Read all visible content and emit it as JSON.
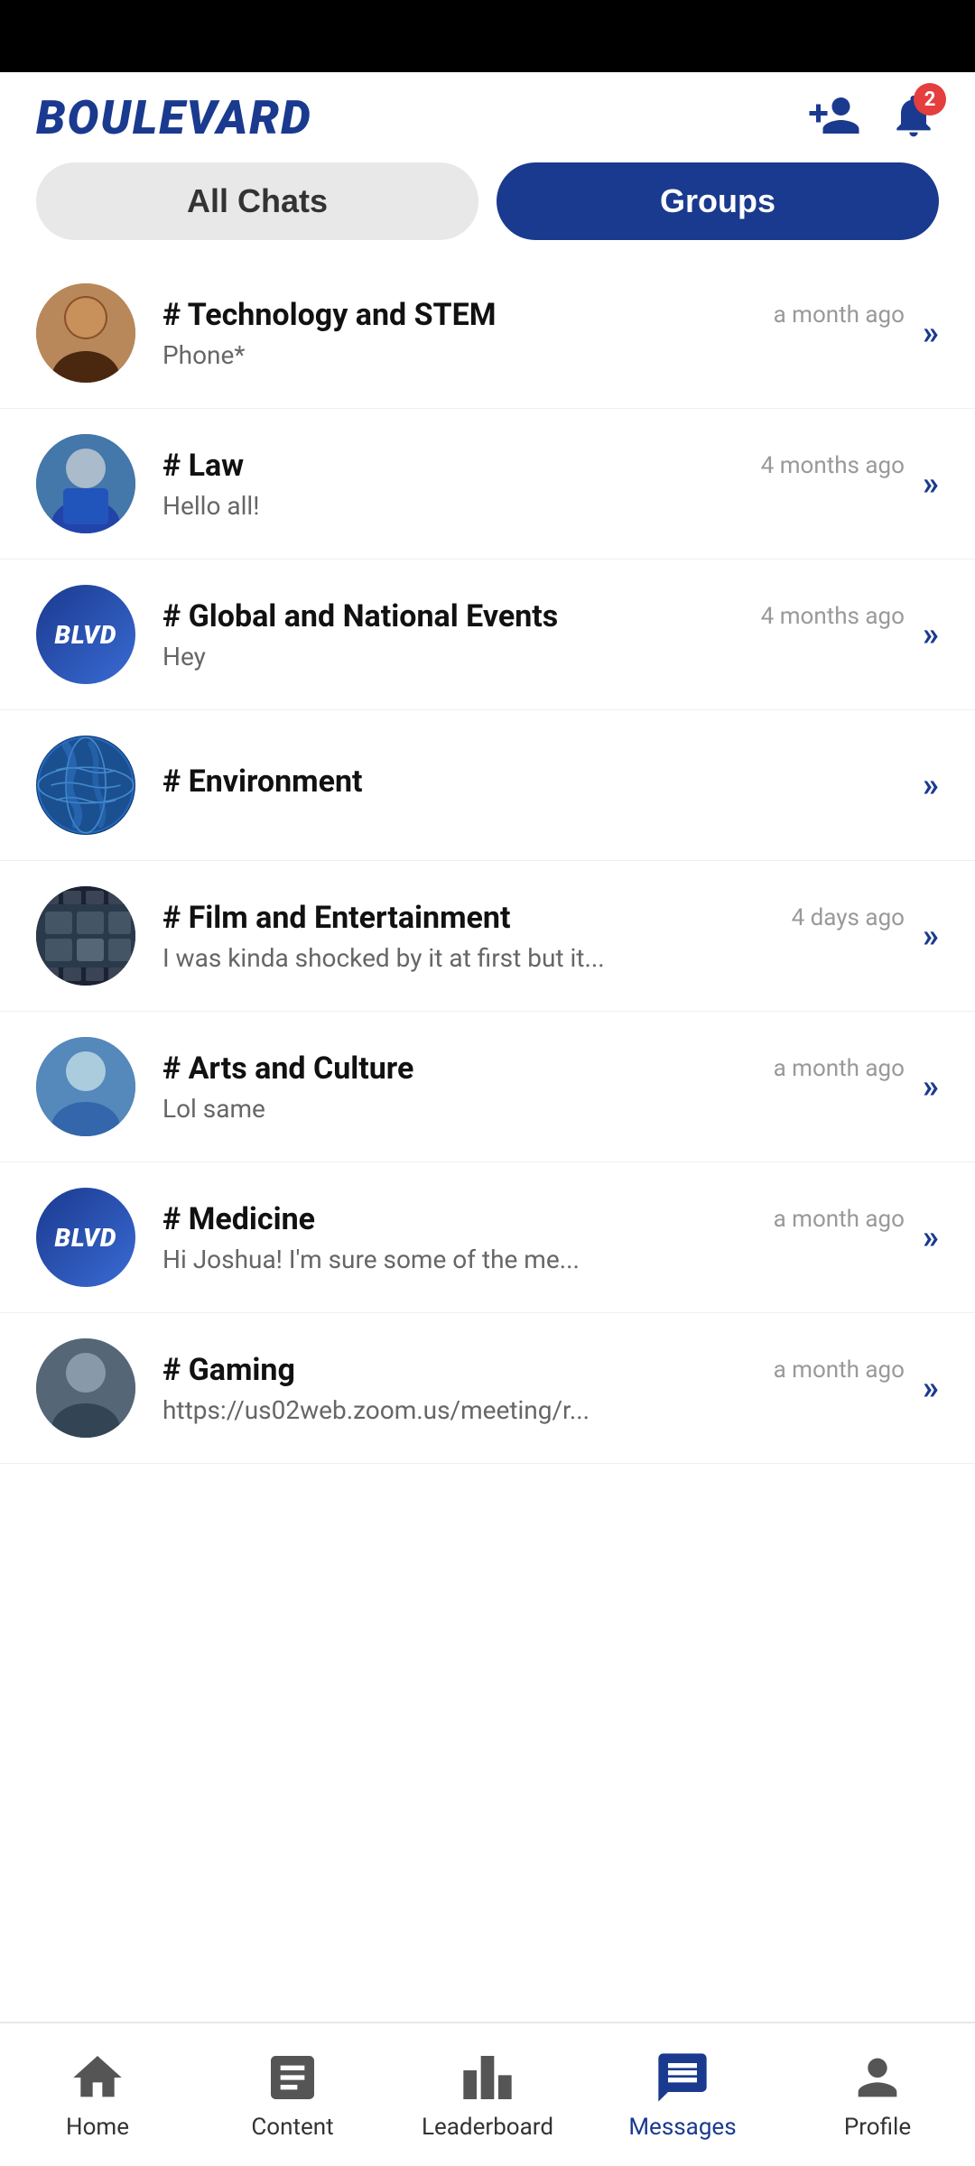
{
  "app": {
    "logo": "BOULEVARD",
    "notification_count": "2"
  },
  "tabs": {
    "all_chats": "All Chats",
    "groups": "Groups",
    "active_tab": "groups"
  },
  "chats": [
    {
      "id": "tech-stem",
      "name": "# Technology and STEM",
      "preview": "Phone*",
      "time": "a month ago",
      "avatar_type": "photo_person",
      "avatar_color": "#c8a882"
    },
    {
      "id": "law",
      "name": "# Law",
      "preview": "Hello all!",
      "time": "4 months ago",
      "avatar_type": "photo_person_blue",
      "avatar_color": "#5577aa"
    },
    {
      "id": "global-events",
      "name": "# Global and National Events",
      "preview": "Hey",
      "time": "4 months ago",
      "avatar_type": "blvd",
      "avatar_color": "#1a3a8f"
    },
    {
      "id": "environment",
      "name": "# Environment",
      "preview": "",
      "time": "",
      "avatar_type": "world",
      "avatar_color": "#1a5090"
    },
    {
      "id": "film-entertainment",
      "name": "# Film and Entertainment",
      "preview": "I was kinda shocked by it at first but it...",
      "time": "4 days ago",
      "avatar_type": "film",
      "avatar_color": "#445566"
    },
    {
      "id": "arts-culture",
      "name": "# Arts and Culture",
      "preview": "Lol same",
      "time": "a month ago",
      "avatar_type": "arts",
      "avatar_color": "#6699cc"
    },
    {
      "id": "medicine",
      "name": "# Medicine",
      "preview": "Hi Joshua! I'm sure some of the me...",
      "time": "a month ago",
      "avatar_type": "blvd",
      "avatar_color": "#1a3a8f"
    },
    {
      "id": "gaming",
      "name": "# Gaming",
      "preview": "https://us02web.zoom.us/meeting/r...",
      "time": "a month ago",
      "avatar_type": "gaming",
      "avatar_color": "#556677"
    }
  ],
  "bottom_nav": {
    "items": [
      {
        "id": "home",
        "label": "Home",
        "active": false
      },
      {
        "id": "content",
        "label": "Content",
        "active": false
      },
      {
        "id": "leaderboard",
        "label": "Leaderboard",
        "active": false
      },
      {
        "id": "messages",
        "label": "Messages",
        "active": true
      },
      {
        "id": "profile",
        "label": "Profile",
        "active": false
      }
    ]
  }
}
